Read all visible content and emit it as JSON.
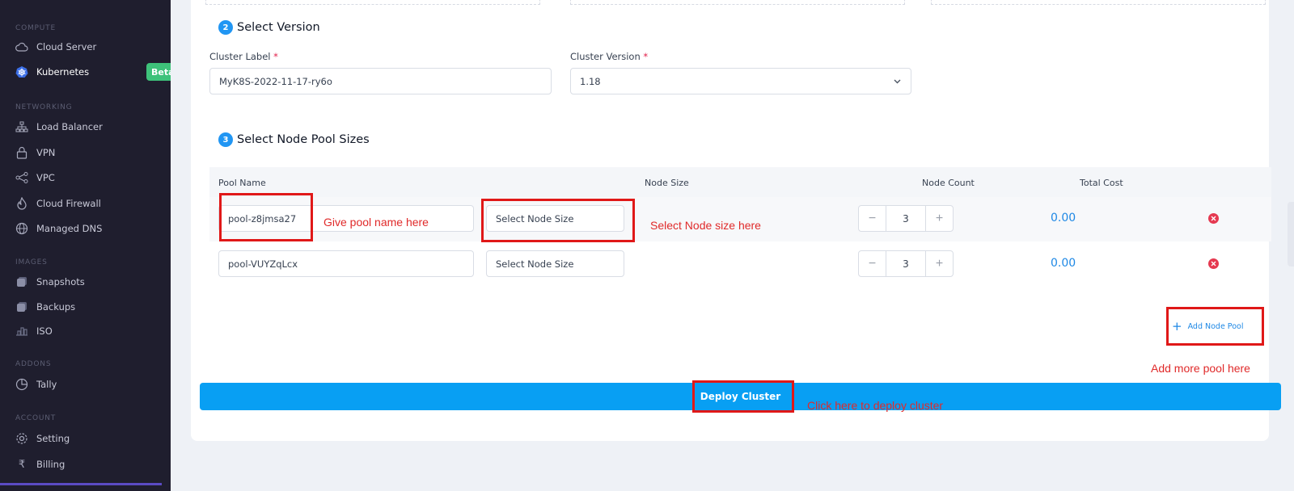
{
  "sidebar": {
    "sections": [
      {
        "title": "COMPUTE",
        "items": [
          {
            "label": "Cloud Server",
            "icon": "cloud-icon"
          },
          {
            "label": "Kubernetes",
            "icon": "kubernetes-icon",
            "badge": "Beta"
          }
        ]
      },
      {
        "title": "NETWORKING",
        "items": [
          {
            "label": "Load Balancer",
            "icon": "network-icon"
          },
          {
            "label": "VPN",
            "icon": "lock-icon"
          },
          {
            "label": "VPC",
            "icon": "share-icon"
          },
          {
            "label": "Cloud Firewall",
            "icon": "fire-icon"
          },
          {
            "label": "Managed DNS",
            "icon": "globe-icon"
          }
        ]
      },
      {
        "title": "IMAGES",
        "items": [
          {
            "label": "Snapshots",
            "icon": "snapshot-icon"
          },
          {
            "label": "Backups",
            "icon": "backup-icon"
          },
          {
            "label": "ISO",
            "icon": "iso-icon"
          }
        ]
      },
      {
        "title": "ADDONS",
        "items": [
          {
            "label": "Tally",
            "icon": "pie-icon"
          }
        ]
      },
      {
        "title": "ACCOUNT",
        "items": [
          {
            "label": "Setting",
            "icon": "gear-icon"
          },
          {
            "label": "Billing",
            "icon": "rupee-icon"
          }
        ]
      }
    ]
  },
  "version_section": {
    "step": "2",
    "title": "Select Version",
    "cluster_label": {
      "label": "Cluster Label",
      "required": "*",
      "value": "MyK8S-2022-11-17-ry6o"
    },
    "cluster_version": {
      "label": "Cluster Version",
      "required": "*",
      "value": "1.18"
    }
  },
  "node_pool_section": {
    "step": "3",
    "title": "Select Node Pool Sizes",
    "columns": {
      "pool_name": "Pool Name",
      "node_size": "Node Size",
      "node_count": "Node Count",
      "total_cost": "Total Cost"
    },
    "rows": [
      {
        "pool_name": "pool-z8jmsa27",
        "node_size": "Select Node Size",
        "count": "3",
        "cost": "0.00"
      },
      {
        "pool_name": "pool-VUYZqLcx",
        "node_size": "Select Node Size",
        "count": "3",
        "cost": "0.00"
      }
    ],
    "add_pool_label": "Add Node Pool",
    "deploy_label": "Deploy Cluster"
  },
  "annotations": {
    "pool_name": "Give pool name here",
    "node_size": "Select Node size here",
    "add_pool": "Add more pool here",
    "deploy": "Click here to deploy cluster"
  },
  "colors": {
    "accent": "#089ff3",
    "sidebar_bg": "#1f1e2e",
    "annotation": "#e01818",
    "beta": "#3ec27a"
  }
}
